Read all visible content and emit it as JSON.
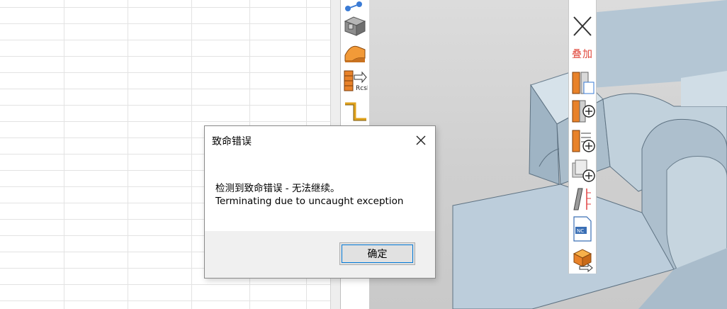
{
  "dialog": {
    "title": "致命错误",
    "message_line1": "检测到致命错误 - 无法继续。",
    "message_line2": "Terminating due to uncaught exception",
    "ok_label": "确定"
  },
  "right_toolbar": {
    "overlay_label": "叠加"
  }
}
